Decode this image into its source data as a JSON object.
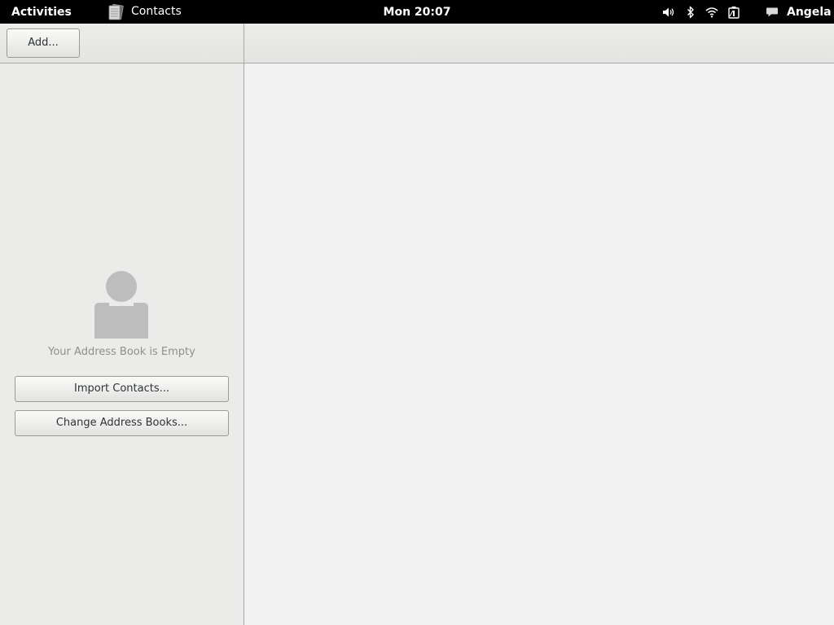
{
  "topbar": {
    "activities_label": "Activities",
    "app_name": "Contacts",
    "clock": "Mon 20:07",
    "user_name": "Angela",
    "status_icons": [
      "volume-icon",
      "bluetooth-icon",
      "wifi-icon",
      "battery-icon",
      "chat-icon"
    ]
  },
  "header": {
    "add_label": "Add..."
  },
  "sidebar": {
    "empty_text": "Your Address Book is Empty",
    "import_label": "Import Contacts...",
    "change_label": "Change Address Books..."
  },
  "colors": {
    "topbar_bg": "#000000",
    "window_bg": "#f2f2f2",
    "sidebar_bg": "#ebebe9",
    "avatar_gray": "#bdbdbd",
    "muted_text": "#8f8f8d"
  }
}
